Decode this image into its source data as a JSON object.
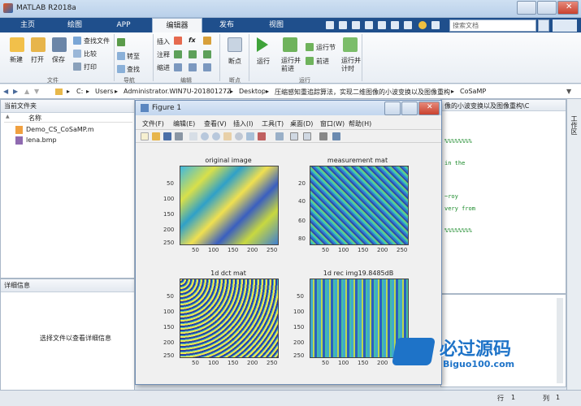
{
  "app": {
    "title": "MATLAB R2018a"
  },
  "tabs": [
    "主页",
    "绘图",
    "APP",
    "编辑器",
    "发布",
    "视图"
  ],
  "search": {
    "placeholder": "搜索文档"
  },
  "ribbon": {
    "new": "新建",
    "open": "打开",
    "save": "保存",
    "find_files": "查找文件",
    "compare": "比较",
    "print": "打印",
    "insert": "插入",
    "comment": "注释",
    "indent": "缩进",
    "fx": "fx",
    "goto": "转至",
    "find": "查找",
    "breakpoint": "断点",
    "run": "运行",
    "run_advance": "运行并\n前进",
    "run_section": "运行节",
    "advance": "前进",
    "run_time": "运行并\n计时",
    "groups": [
      "文件",
      "导航",
      "编辑",
      "断点",
      "运行"
    ]
  },
  "address": {
    "parts": [
      "C:",
      "Users",
      "Administrator.WIN7U-20180127Z",
      "Desktop",
      "压缩感知重追踪算法，实现二维图像的小波变换以及图像重构",
      "CoSaMP"
    ]
  },
  "current_folder": {
    "title": "当前文件夹",
    "column": "名称",
    "files": [
      "Demo_CS_CoSaMP.m",
      "lena.bmp"
    ],
    "sort_arrow": "▲"
  },
  "details": {
    "title": "详细信息",
    "text": "选择文件以查看详细信息"
  },
  "editor": {
    "title_trunc": "像的小波变换以及图像重构\\C",
    "side_label": "工作区",
    "code_lines": [
      "%%%%%%%%",
      "in the",
      "~roy",
      "very from",
      "%%%%%%%%"
    ]
  },
  "figure": {
    "title": "Figure 1",
    "menu": [
      "文件(F)",
      "编辑(E)",
      "查看(V)",
      "插入(I)",
      "工具(T)",
      "桌面(D)",
      "窗口(W)",
      "帮助(H)"
    ],
    "plots": [
      {
        "title": "original image",
        "yticks": [
          "50",
          "100",
          "150",
          "200",
          "250"
        ],
        "xticks": [
          "50",
          "100",
          "150",
          "200",
          "250"
        ]
      },
      {
        "title": "measurement mat",
        "yticks": [
          "20",
          "40",
          "60",
          "80"
        ],
        "xticks": [
          "50",
          "100",
          "150",
          "200",
          "250"
        ]
      },
      {
        "title": "1d dct mat",
        "yticks": [
          "50",
          "100",
          "150",
          "200",
          "250"
        ],
        "xticks": [
          "50",
          "100",
          "150",
          "200",
          "250"
        ]
      },
      {
        "title": "1d rec img19.8485dB",
        "yticks": [
          "50",
          "100",
          "150",
          "200",
          "250"
        ],
        "xticks": [
          "50",
          "100",
          "150",
          "200",
          "250"
        ]
      }
    ]
  },
  "status": {
    "row_label": "行",
    "row": "1",
    "col_label": "列",
    "col": "1"
  },
  "watermark": {
    "brand": "必过源码",
    "url": "Biguo100.com"
  }
}
